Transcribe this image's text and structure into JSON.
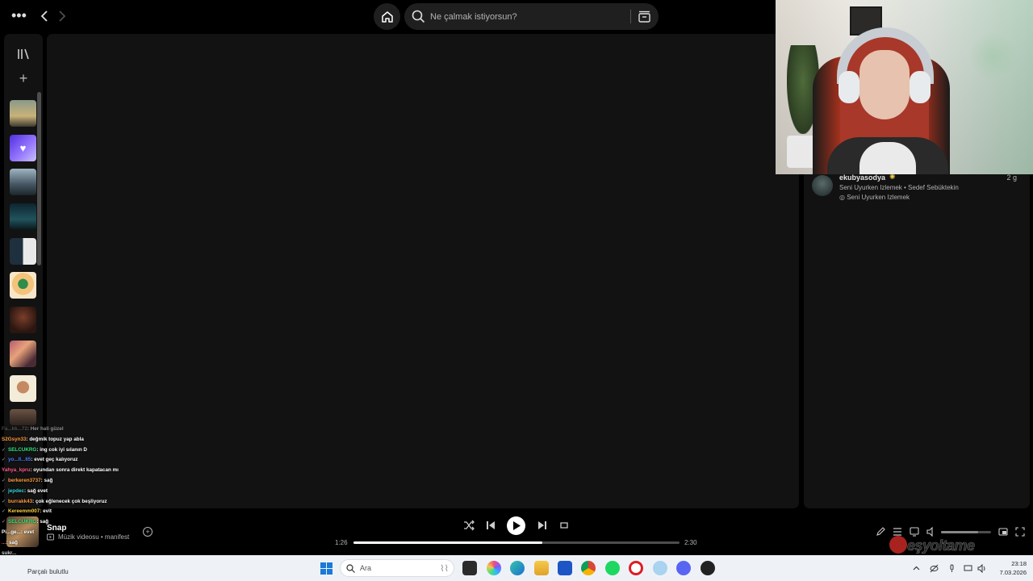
{
  "search": {
    "placeholder": "Ne çalmak istiyorsun?"
  },
  "friend_activity": {
    "name": "ekubyasodya",
    "time_ago": "2 g",
    "track": "Seni Uyurken Izlemek • Sedef Sebüktekin",
    "context": "Seni Uyurken Izlemek"
  },
  "chat": [
    {
      "user": "Fa...kk...72",
      "color": "#888888",
      "message": ": Her hali güzel",
      "faded": true
    },
    {
      "user": "S2Gsyn33",
      "color": "#ff9b3d",
      "message": ": değmik topuz yap abla"
    },
    {
      "user": "SELCUKRG",
      "color": "#2fe37a",
      "message": ": ing cok iyi sılanın D",
      "badge": true
    },
    {
      "user": "yo...ll...65",
      "color": "#4a7dff",
      "message": ": evet geç kalıyoruz",
      "badge": true
    },
    {
      "user": "Yahya_kpru",
      "color": "#ff5c8a",
      "message": ": oyundan sonra direkt kapatacan mı"
    },
    {
      "user": "berkeren3737",
      "color": "#ff9b3d",
      "message": ": sağ",
      "badge": true
    },
    {
      "user": "jepdec",
      "color": "#33d6d6",
      "message": ": sağ evet",
      "badge": true
    },
    {
      "user": "burrakk43",
      "color": "#ff9b3d",
      "message": ": çok eğlenecek çok beşliyoruz",
      "badge": true
    },
    {
      "user": "Kereemm007",
      "color": "#ffd23d",
      "message": ": evit",
      "badge": true
    },
    {
      "user": "SELCUKRG",
      "color": "#2fe37a",
      "message": ": sağ",
      "badge": true
    },
    {
      "user": "Pi...ge...",
      "color": "#ffffff",
      "message": ": evet"
    },
    {
      "user": "...",
      "color": "#ff5c5c",
      "message": ": sağ"
    },
    {
      "user": "sukr...",
      "color": "#cccccc",
      "message": ""
    }
  ],
  "now_playing": {
    "title": "Snap",
    "subtitle": "Müzik videosu • manifest",
    "elapsed": "1:26",
    "duration": "2:30",
    "progress": 0.578
  },
  "volume": {
    "level": 0.74
  },
  "watermark": "eşyoltame",
  "taskbar": {
    "search_label": "Ara",
    "overlay_text": "Parçalı bulutlu",
    "time": "23:18",
    "date": "7.03.2026"
  },
  "colors": {
    "background": "#000000",
    "panel": "#121212",
    "text_secondary": "#b3b3b3",
    "accent_green": "#1ed760"
  },
  "icons": [
    "more-icon",
    "back-icon",
    "forward-icon",
    "home-icon",
    "search-icon",
    "browse-icon",
    "library-icon",
    "plus-icon",
    "shuffle-icon",
    "previous-icon",
    "play-icon",
    "next-icon",
    "repeat-icon",
    "lyrics-icon",
    "queue-icon",
    "connect-icon",
    "volume-icon",
    "miniplayer-icon",
    "fullscreen-icon"
  ]
}
